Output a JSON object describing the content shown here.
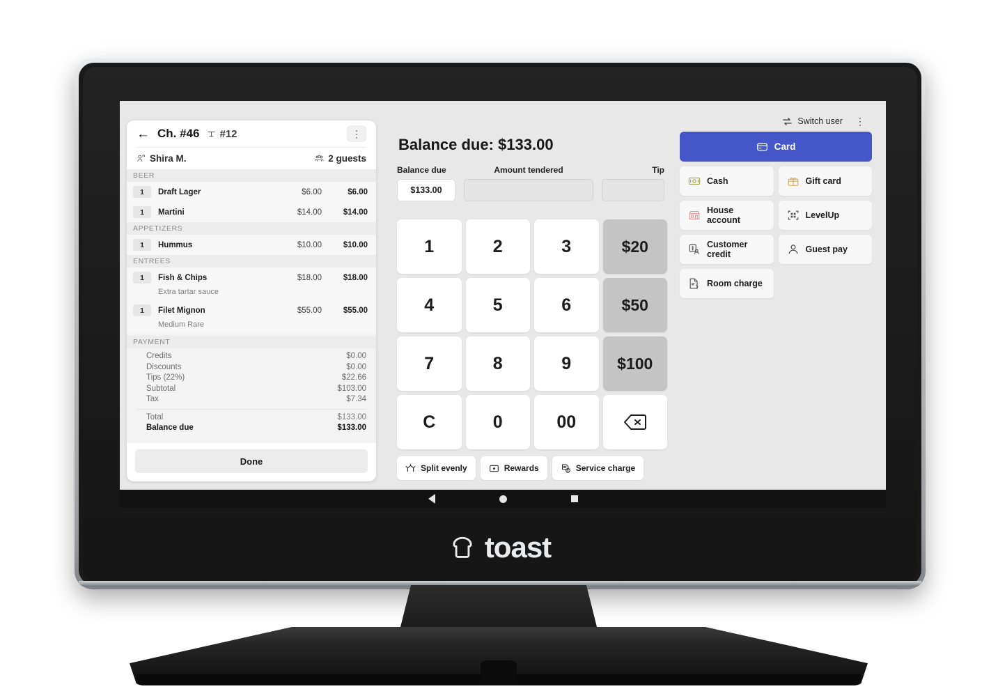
{
  "device": {
    "brand": "toast",
    "nav": {
      "back": "back-triangle",
      "home": "home-circle",
      "recent": "recent-square"
    }
  },
  "order": {
    "back_icon": "←",
    "check_number": "Ch. #46",
    "table_number": "#12",
    "kebab": "⋮",
    "guest_name": "Shira M.",
    "guest_count": "2 guests",
    "done_label": "Done",
    "categories": [
      {
        "name": "BEER",
        "items": [
          {
            "qty": "1",
            "name": "Draft Lager",
            "unit": "$6.00",
            "total": "$6.00",
            "mod": ""
          },
          {
            "qty": "1",
            "name": "Martini",
            "unit": "$14.00",
            "total": "$14.00",
            "mod": ""
          }
        ]
      },
      {
        "name": "APPETIZERS",
        "items": [
          {
            "qty": "1",
            "name": "Hummus",
            "unit": "$10.00",
            "total": "$10.00",
            "mod": ""
          }
        ]
      },
      {
        "name": "ENTREES",
        "items": [
          {
            "qty": "1",
            "name": "Fish & Chips",
            "unit": "$18.00",
            "total": "$18.00",
            "mod": "Extra tartar sauce"
          },
          {
            "qty": "1",
            "name": "Filet Mignon",
            "unit": "$55.00",
            "total": "$55.00",
            "mod": "Medium Rare"
          }
        ]
      }
    ],
    "payment_header": "PAYMENT",
    "payment_lines": [
      {
        "label": "Credits",
        "value": "$0.00"
      },
      {
        "label": "Discounts",
        "value": "$0.00"
      },
      {
        "label": "Tips (22%)",
        "value": "$22.66"
      },
      {
        "label": "Subtotal",
        "value": "$103.00"
      },
      {
        "label": "Tax",
        "value": "$7.34"
      }
    ],
    "total_label": "Total",
    "total_value": "$133.00",
    "balance_label": "Balance due",
    "balance_value": "$133.00"
  },
  "topbar": {
    "switch_user": "Switch user",
    "kebab": "⋮"
  },
  "main": {
    "title": "Balance due: $133.00",
    "fields": {
      "balance_label": "Balance due",
      "balance_value": "$133.00",
      "tendered_label": "Amount tendered",
      "tendered_value": "",
      "tip_label": "Tip",
      "tip_value": ""
    },
    "keypad": [
      {
        "label": "1",
        "kind": "digit"
      },
      {
        "label": "2",
        "kind": "digit"
      },
      {
        "label": "3",
        "kind": "digit"
      },
      {
        "label": "$20",
        "kind": "quick"
      },
      {
        "label": "4",
        "kind": "digit"
      },
      {
        "label": "5",
        "kind": "digit"
      },
      {
        "label": "6",
        "kind": "digit"
      },
      {
        "label": "$50",
        "kind": "quick"
      },
      {
        "label": "7",
        "kind": "digit"
      },
      {
        "label": "8",
        "kind": "digit"
      },
      {
        "label": "9",
        "kind": "digit"
      },
      {
        "label": "$100",
        "kind": "quick"
      },
      {
        "label": "C",
        "kind": "digit"
      },
      {
        "label": "0",
        "kind": "digit"
      },
      {
        "label": "00",
        "kind": "digit"
      },
      {
        "label": "",
        "kind": "backspace"
      }
    ],
    "actions": [
      {
        "label": "Split evenly",
        "icon": "split-icon"
      },
      {
        "label": "Rewards",
        "icon": "rewards-icon"
      },
      {
        "label": "Service charge",
        "icon": "service-charge-icon"
      }
    ],
    "methods_primary": {
      "label": "Card",
      "icon": "credit-card-icon"
    },
    "methods": [
      {
        "label": "Cash",
        "icon": "cash-icon",
        "color": "#a7a85a"
      },
      {
        "label": "Gift card",
        "icon": "gift-card-icon",
        "color": "#d8ae5a"
      },
      {
        "label": "House account",
        "icon": "house-account-icon",
        "color": "#d99a9a"
      },
      {
        "label": "LevelUp",
        "icon": "qr-code-icon",
        "color": "#555555"
      },
      {
        "label": "Customer credit",
        "icon": "customer-credit-icon",
        "color": "#555555"
      },
      {
        "label": "Guest pay",
        "icon": "person-icon",
        "color": "#555555"
      },
      {
        "label": "Room charge",
        "icon": "room-charge-icon",
        "color": "#555555"
      }
    ]
  },
  "colors": {
    "accent": "#4456c8",
    "quick_key": "#c4c4c4",
    "screen_bg": "#e8e8e8"
  }
}
